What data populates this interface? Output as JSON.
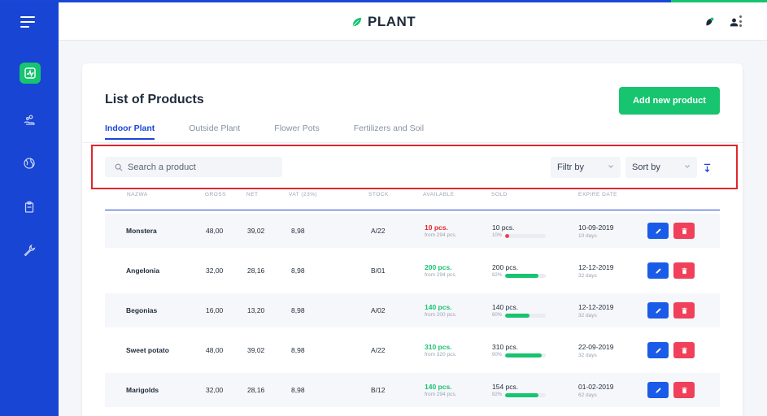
{
  "app": {
    "title": "PLANT"
  },
  "colors": {
    "primary": "#1845d3",
    "accent_green": "#17c46f",
    "danger": "#f0405a",
    "edit_blue": "#1a5be8",
    "low_stock_red": "#e0262e",
    "highlight": "#e0262e"
  },
  "sidebar": {
    "items": [
      {
        "icon": "activity-chart-icon",
        "active": true
      },
      {
        "icon": "plant-hand-icon",
        "active": false
      },
      {
        "icon": "globe-icon",
        "active": false
      },
      {
        "icon": "clipboard-icon",
        "active": false
      },
      {
        "icon": "wrench-icon",
        "active": false
      }
    ]
  },
  "header": {
    "icons": [
      "notification-leaf-icon",
      "user-icon",
      "more-vertical-icon"
    ]
  },
  "main": {
    "title": "List of Products",
    "add_button": "Add new product",
    "tabs": [
      {
        "label": "Indoor Plant",
        "active": true
      },
      {
        "label": "Outside Plant",
        "active": false
      },
      {
        "label": "Flower Pots",
        "active": false
      },
      {
        "label": "Fertilizers and Soil",
        "active": false
      }
    ],
    "search": {
      "placeholder": "Search a product"
    },
    "filter": {
      "label": "Filtr by"
    },
    "sort": {
      "label": "Sort by"
    }
  },
  "table": {
    "columns": [
      "NAZWA",
      "GROSS",
      "NET",
      "VAT (23%)",
      "STOCK",
      "AVAILABLE",
      "SOLD",
      "EXPIRE DATE"
    ],
    "rows": [
      {
        "name": "Monstera",
        "gross": "48,00",
        "net": "39,02",
        "vat": "8,98",
        "stock": "A/22",
        "available": "10 pcs.",
        "available_from": "from 294 pcs.",
        "available_status": "low",
        "sold": "10 pcs.",
        "sold_pct": "10%",
        "sold_fraction": 0.1,
        "expire": "10-09-2019",
        "expire_days": "10 days"
      },
      {
        "name": "Angelonia",
        "gross": "32,00",
        "net": "28,16",
        "vat": "8,98",
        "stock": "B/01",
        "available": "200 pcs.",
        "available_from": "from 294 pcs.",
        "available_status": "ok",
        "sold": "200 pcs.",
        "sold_pct": "82%",
        "sold_fraction": 0.82,
        "expire": "12-12-2019",
        "expire_days": "32 days"
      },
      {
        "name": "Begonias",
        "gross": "16,00",
        "net": "13,20",
        "vat": "8,98",
        "stock": "A/02",
        "available": "140 pcs.",
        "available_from": "from 200 pcs.",
        "available_status": "ok",
        "sold": "140 pcs.",
        "sold_pct": "60%",
        "sold_fraction": 0.6,
        "expire": "12-12-2019",
        "expire_days": "32 days"
      },
      {
        "name": "Sweet potato",
        "gross": "48,00",
        "net": "39,02",
        "vat": "8,98",
        "stock": "A/22",
        "available": "310 pcs.",
        "available_from": "from 320 pcs.",
        "available_status": "ok",
        "sold": "310 pcs.",
        "sold_pct": "90%",
        "sold_fraction": 0.9,
        "expire": "22-09-2019",
        "expire_days": "32 days"
      },
      {
        "name": "Marigolds",
        "gross": "32,00",
        "net": "28,16",
        "vat": "8,98",
        "stock": "B/12",
        "available": "140 pcs.",
        "available_from": "from 294 pcs.",
        "available_status": "ok",
        "sold": "154 pcs.",
        "sold_pct": "82%",
        "sold_fraction": 0.82,
        "expire": "01-02-2019",
        "expire_days": "62 days"
      }
    ]
  }
}
